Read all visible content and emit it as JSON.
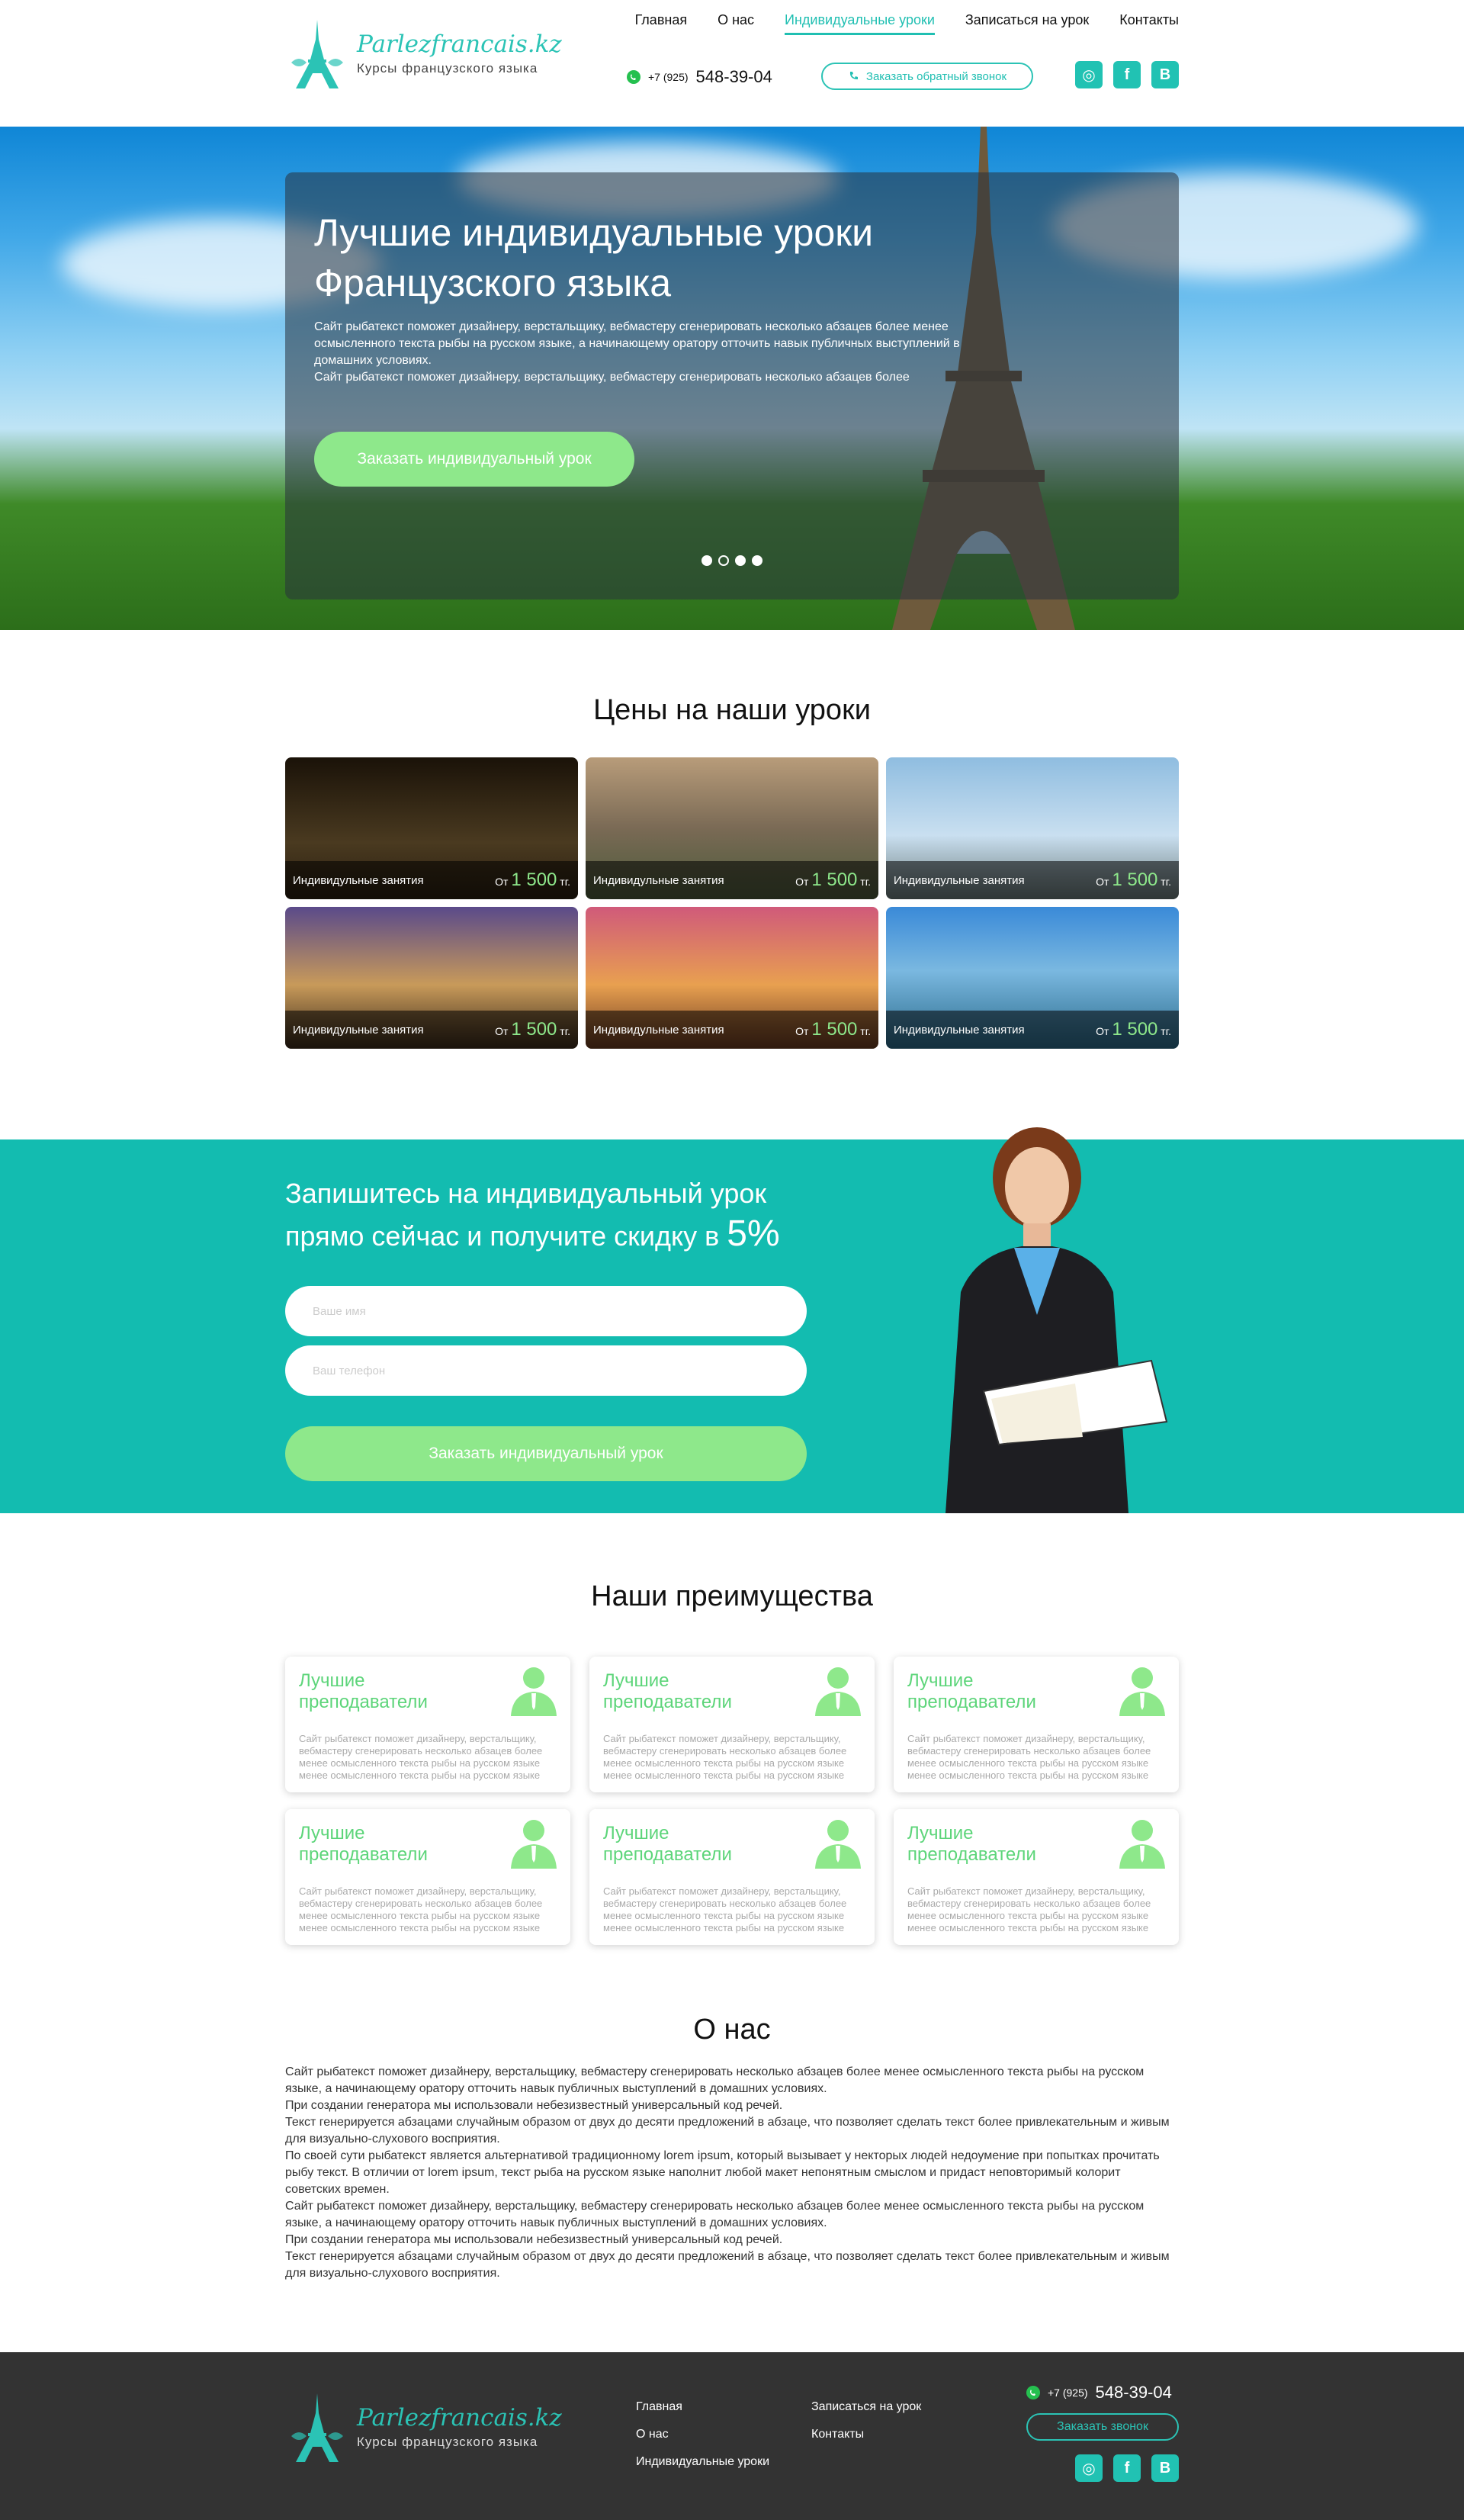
{
  "brand": {
    "title": "Parlezfrancais.kz",
    "subtitle": "Курсы французского языка",
    "color": "#20bfb2"
  },
  "nav": [
    {
      "label": "Главная"
    },
    {
      "label": "О нас"
    },
    {
      "label": "Индивидуальные уроки",
      "active": true
    },
    {
      "label": "Записаться на урок"
    },
    {
      "label": "Контакты"
    }
  ],
  "header": {
    "phone_prefix": "+7 (925)",
    "phone_number": "548-39-04",
    "callback_label": "Заказать обратный звонок",
    "socials": [
      "instagram-icon",
      "facebook-icon",
      "vk-icon"
    ]
  },
  "hero": {
    "title": "Лучшие индивидуальные уроки",
    "subtitle": "Французского языка",
    "text1": "Сайт рыбатекст поможет дизайнеру, верстальщику, вебмастеру сгенерировать несколько абзацев более менее осмысленного текста рыбы на русском языке, а начинающему оратору отточить навык публичных выступлений в домашних условиях.",
    "text2": "Сайт рыбатекст поможет дизайнеру, верстальщику, вебмастеру сгенерировать несколько абзацев более",
    "button": "Заказать индивидуальный урок",
    "slides": 4,
    "active_slide": 1
  },
  "prices": {
    "title": "Цены на наши уроки",
    "cards": [
      {
        "label": "Индивидульные занятия",
        "from": "От",
        "price": "1 500",
        "unit": "тг."
      },
      {
        "label": "Индивидульные занятия",
        "from": "От",
        "price": "1 500",
        "unit": "тг."
      },
      {
        "label": "Индивидульные занятия",
        "from": "От",
        "price": "1 500",
        "unit": "тг."
      },
      {
        "label": "Индивидульные занятия",
        "from": "От",
        "price": "1 500",
        "unit": "тг."
      },
      {
        "label": "Индивидульные занятия",
        "from": "От",
        "price": "1 500",
        "unit": "тг."
      },
      {
        "label": "Индивидульные занятия",
        "from": "От",
        "price": "1 500",
        "unit": "тг."
      }
    ]
  },
  "signup": {
    "title": "Запишитесь на индивидуальный урок",
    "subtitle": "прямо сейчас и получите скидку в",
    "discount": "5%",
    "name_placeholder": "Ваше имя",
    "phone_placeholder": "Ваш телефон",
    "button": "Заказать индивидуальный урок"
  },
  "advantages": {
    "title": "Наши преимущества",
    "cards": [
      {
        "title": "Лучшие преподаватели",
        "text": "Сайт рыбатекст поможет дизайнеру, верстальщику, вебмастеру сгенерировать несколько абзацев более менее осмысленного текста рыбы на русском языке менее осмысленного текста рыбы на русском языке"
      },
      {
        "title": "Лучшие преподаватели",
        "text": "Сайт рыбатекст поможет дизайнеру, верстальщику, вебмастеру сгенерировать несколько абзацев более менее осмысленного текста рыбы на русском языке менее осмысленного текста рыбы на русском языке"
      },
      {
        "title": "Лучшие преподаватели",
        "text": "Сайт рыбатекст поможет дизайнеру, верстальщику, вебмастеру сгенерировать несколько абзацев более менее осмысленного текста рыбы на русском языке менее осмысленного текста рыбы на русском языке"
      },
      {
        "title": "Лучшие преподаватели",
        "text": "Сайт рыбатекст поможет дизайнеру, верстальщику, вебмастеру сгенерировать несколько абзацев более менее осмысленного текста рыбы на русском языке менее осмысленного текста рыбы на русском языке"
      },
      {
        "title": "Лучшие преподаватели",
        "text": "Сайт рыбатекст поможет дизайнеру, верстальщику, вебмастеру сгенерировать несколько абзацев более менее осмысленного текста рыбы на русском языке менее осмысленного текста рыбы на русском языке"
      },
      {
        "title": "Лучшие преподаватели",
        "text": "Сайт рыбатекст поможет дизайнеру, верстальщику, вебмастеру сгенерировать несколько абзацев более менее осмысленного текста рыбы на русском языке менее осмысленного текста рыбы на русском языке"
      }
    ]
  },
  "about": {
    "title": "О нас",
    "paragraphs": [
      "Сайт рыбатекст поможет дизайнеру, верстальщику, вебмастеру сгенерировать несколько абзацев более менее осмысленного текста рыбы на русском языке, а начинающему оратору отточить навык публичных выступлений в домашних условиях.",
      "При создании генератора мы использовали небезизвестный универсальный код речей.",
      "Текст генерируется абзацами случайным образом от двух до десяти предложений в абзаце, что позволяет сделать текст более привлекательным и живым для визуально-слухового восприятия.",
      "По своей сути рыбатекст является альтернативой традиционному lorem ipsum, который вызывает у некторых людей недоумение при попытках прочитать рыбу текст. В отличии от lorem ipsum, текст рыба на русском языке наполнит любой макет непонятным смыслом и придаст неповторимый колорит советских времен.",
      "Сайт рыбатекст поможет дизайнеру, верстальщику, вебмастеру сгенерировать несколько абзацев более менее осмысленного текста рыбы на русском языке, а начинающему оратору отточить навык публичных выступлений в домашних условиях.",
      "При создании генератора мы использовали небезизвестный универсальный код речей.",
      "Текст генерируется абзацами случайным образом от двух до десяти предложений в абзаце, что позволяет сделать текст более привлекательным и живым для визуально-слухового восприятия."
    ]
  },
  "footer": {
    "nav_col1": [
      "Главная",
      "О нас",
      "Индивидуальные уроки"
    ],
    "nav_col2": [
      "Записаться на урок",
      "Контакты"
    ],
    "phone_prefix": "+7 (925)",
    "phone_number": "548-39-04",
    "callback_label": "Заказать звонок"
  },
  "colors": {
    "accent": "#20bfb2",
    "green": "#8ee88b",
    "footer_bg": "#333333",
    "signup_bg": "#13bcb0"
  }
}
